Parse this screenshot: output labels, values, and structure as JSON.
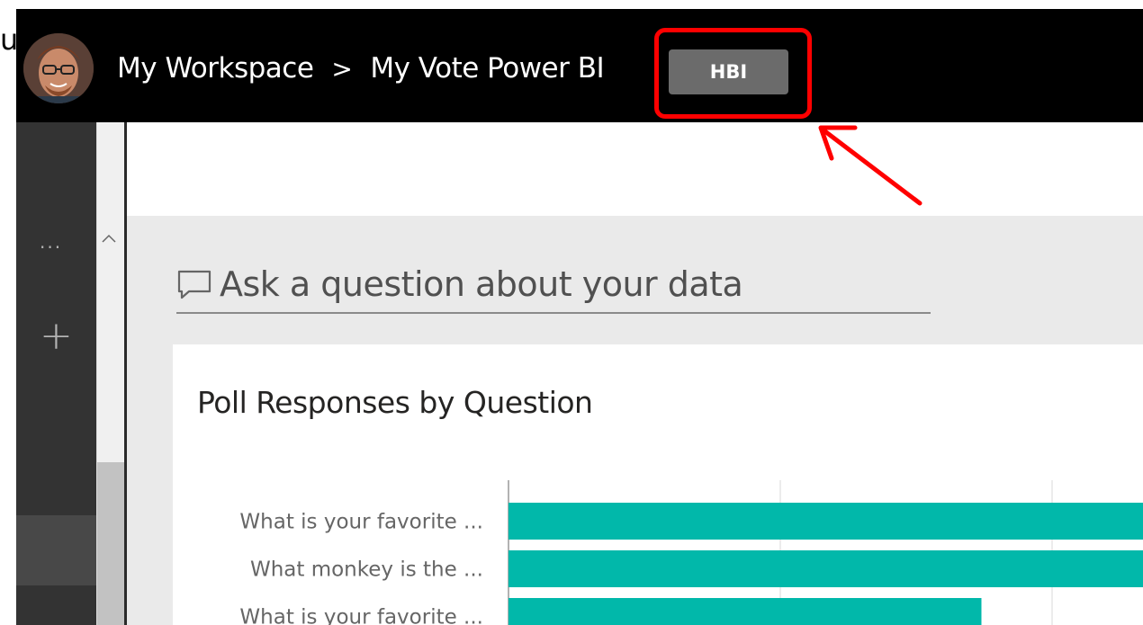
{
  "header": {
    "stray_text": "u",
    "breadcrumb": [
      {
        "label": "My Workspace"
      },
      {
        "label": "My Vote Power BI"
      }
    ],
    "separator": ">",
    "badge": "HBI"
  },
  "sidebar": {
    "more_label": "...",
    "add_label": "+"
  },
  "qna": {
    "placeholder": "Ask a question about your data"
  },
  "tile": {
    "title": "Poll Responses by Question"
  },
  "chart_data": {
    "type": "bar",
    "orientation": "horizontal",
    "categories": [
      "What is your favorite ...",
      "What monkey is the ...",
      "What is your favorite ..."
    ],
    "values": [
      100,
      84,
      58
    ],
    "xlim": [
      0,
      100
    ],
    "grid": true,
    "bar_color": "#01B8AA"
  },
  "colors": {
    "topbar": "#000000",
    "badge": "#6b6b6b",
    "highlight": "#ff0000",
    "bar": "#01B8AA",
    "rail": "#333333"
  },
  "icons": [
    "avatar",
    "chevron-right-icon",
    "comment-icon",
    "ellipsis-icon",
    "plus-icon",
    "chevron-up-icon",
    "red-arrow"
  ]
}
